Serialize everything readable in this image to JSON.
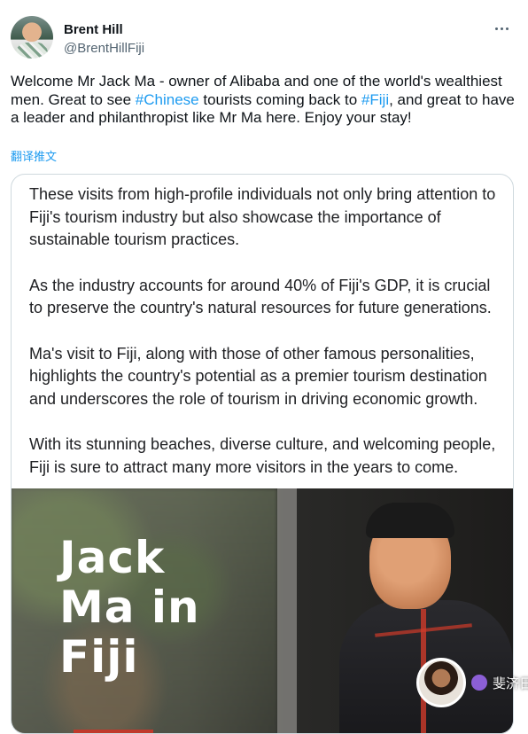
{
  "author": {
    "display_name": "Brent Hill",
    "handle": "@BrentHillFiji"
  },
  "tweet": {
    "text_1": "Welcome Mr Jack Ma - owner of Alibaba and one of the world's wealthiest men. Great to see ",
    "hashtag_1": "#Chinese",
    "text_2": " tourists coming back to ",
    "hashtag_2": "#Fiji",
    "text_3": ", and great to have a leader and philanthropist like Mr Ma here. Enjoy your stay!",
    "translate_label": "翻译推文"
  },
  "media": {
    "paragraphs": [
      {
        "line_1": "These visits from high-profile individuals not only bring attention to",
        "line_2": "Fiji's tourism industry but also showcase the importance of",
        "line_3": "sustainable tourism practices."
      },
      {
        "line_1": "As the industry accounts for around 40% of Fiji's GDP, it is crucial",
        "line_2": "to preserve the country's natural resources for future generations."
      },
      {
        "line_1": "Ma's visit to Fiji, along with those of other famous personalities,",
        "line_2": "highlights the country's potential as a premier tourism destination",
        "line_3": "and underscores the role of tourism in driving economic growth."
      },
      {
        "line_1": "With its stunning beaches, diverse culture, and welcoming people,",
        "line_2": "Fiji is sure to attract many more visitors in the years to come."
      }
    ],
    "headline_line_1": "Jack",
    "headline_line_2": "Ma in",
    "headline_line_3": "Fiji"
  },
  "watermark": {
    "label": "斐济日报"
  },
  "colors": {
    "link": "#1d9bf0",
    "secondary_text": "#536471",
    "border": "#cfd9de"
  },
  "icons": {
    "more": "more-horizontal-icon"
  }
}
